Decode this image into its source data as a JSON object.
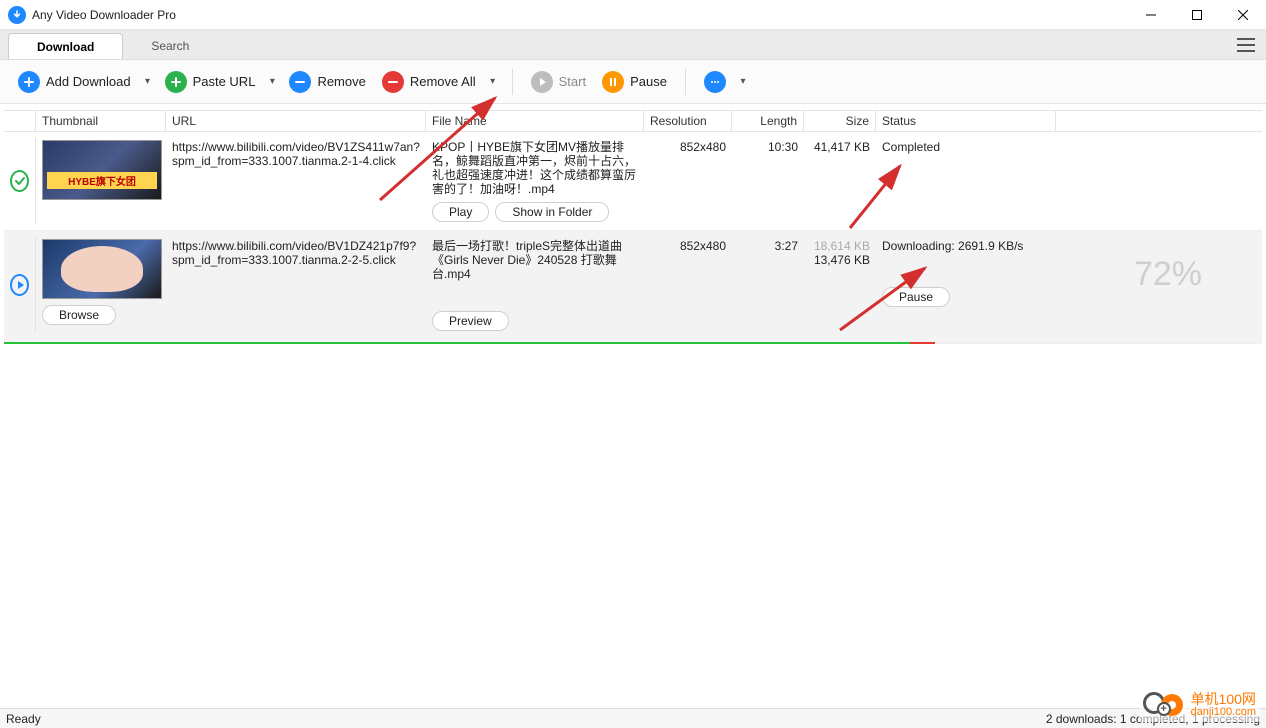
{
  "title": "Any Video Downloader Pro",
  "tabs": {
    "download": "Download",
    "search": "Search"
  },
  "toolbar": {
    "add": "Add Download",
    "paste": "Paste URL",
    "remove": "Remove",
    "remove_all": "Remove All",
    "start": "Start",
    "pause": "Pause"
  },
  "columns": {
    "thumb": "Thumbnail",
    "url": "URL",
    "file": "File Name",
    "res": "Resolution",
    "len": "Length",
    "size": "Size",
    "status": "Status"
  },
  "rows": [
    {
      "url": "https://www.bilibili.com/video/BV1ZS411w7an?spm_id_from=333.1007.tianma.2-1-4.click",
      "file": "KPOP丨HYBE旗下女团MV播放量排名，鲸舞蹈版直冲第一，烬前十占六，礼也超强速度冲进！这个成绩都算蛮厉害的了！加油呀！.mp4",
      "res": "852x480",
      "len": "10:30",
      "size": "41,417 KB",
      "status": "Completed",
      "thumb_band": "HYBE旗下女团",
      "btn1": "Play",
      "btn2": "Show in Folder"
    },
    {
      "url": "https://www.bilibili.com/video/BV1DZ421p7f9?spm_id_from=333.1007.tianma.2-2-5.click",
      "file": "最后一场打歌！tripleS完整体出道曲《Girls Never Die》240528 打歌舞台.mp4",
      "res": "852x480",
      "len": "3:27",
      "size_total": "18,614 KB",
      "size_done": "13,476 KB",
      "status": "Downloading: 2691.9 KB/s",
      "percent": "72%",
      "btn1": "Browse",
      "btn2": "Preview",
      "btn3": "Pause"
    }
  ],
  "statusbar": {
    "left": "Ready",
    "right": "2 downloads: 1 completed, 1 processing"
  },
  "watermark": {
    "name": "单机100网",
    "domain": "danji100.com"
  }
}
